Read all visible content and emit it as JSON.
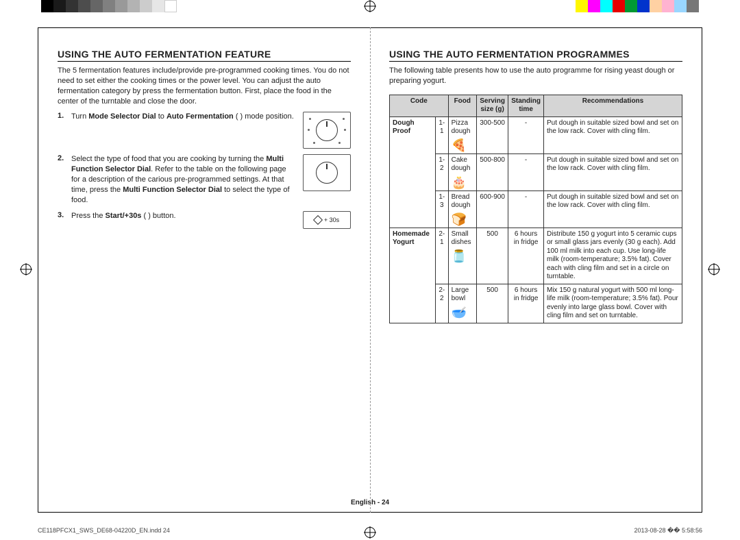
{
  "left": {
    "heading": "USING THE AUTO FERMENTATION FEATURE",
    "intro": "The 5 fermentation features include/provide pre-programmed cooking times. You do not need to set either the cooking times or the power level. You can adjust the auto fermentation category by press the fermentation button. First, place the food in the center of the turntable and close the door.",
    "step1_num": "1.",
    "step1_a": "Turn ",
    "step1_b": "Mode Selector Dial",
    "step1_c": " to ",
    "step1_d": "Auto Fermentation",
    "step1_e": " (      ) mode position.",
    "step2_num": "2.",
    "step2_a": "Select the type of food that you are cooking by turning the ",
    "step2_b": "Multi Function Selector Dial",
    "step2_c": ". Refer to the table on the following page for a description of the carious pre-programmed settings. At that time, press the ",
    "step2_d": "Multi Function Selector Dial",
    "step2_e": " to select the type of food.",
    "step3_num": "3.",
    "step3_a": "Press the ",
    "step3_b": "Start/+30s",
    "step3_c": " (    ) button.",
    "btn_label": "+ 30s"
  },
  "right": {
    "heading": "USING THE AUTO FERMENTATION PROGRAMMES",
    "intro": "The following table presents how to use the auto programme for rising yeast dough or preparing yogurt.",
    "th_code": "Code",
    "th_food": "Food",
    "th_size": "Serving size (g)",
    "th_stand": "Standing time",
    "th_rec": "Recommendations",
    "cat1": "Dough Proof",
    "cat2": "Homemade Yogurt",
    "rows": [
      {
        "code": "1-1",
        "food": "Pizza dough",
        "size": "300-500",
        "stand": "-",
        "rec": "Put dough in suitable sized bowl and set on the low rack. Cover with cling film."
      },
      {
        "code": "1-2",
        "food": "Cake dough",
        "size": "500-800",
        "stand": "-",
        "rec": "Put dough in suitable sized bowl and set on the low rack. Cover with cling film."
      },
      {
        "code": "1-3",
        "food": "Bread dough",
        "size": "600-900",
        "stand": "-",
        "rec": "Put dough in suitable sized bowl and set on the low rack. Cover with cling film."
      },
      {
        "code": "2-1",
        "food": "Small dishes",
        "size": "500",
        "stand": "6 hours in fridge",
        "rec": "Distribute 150 g yogurt into 5 ceramic cups or small glass jars evenly (30 g each). Add 100 ml milk into each cup. Use long-life milk (room-temperature; 3.5% fat). Cover each with cling film and set in a circle on turntable."
      },
      {
        "code": "2-2",
        "food": "Large bowl",
        "size": "500",
        "stand": "6 hours in fridge",
        "rec": "Mix 150 g natural yogurt with 500 ml long-life milk (room-temperature; 3.5% fat). Pour evenly into large glass bowl. Cover with cling film and set on turntable."
      }
    ]
  },
  "footer": {
    "center": "English - 24",
    "file": "CE118PFCX1_SWS_DE68-04220D_EN.indd   24",
    "date": "2013-08-28   �� 5:58:56"
  },
  "colors": {
    "left_bars": [
      "#000",
      "#1a1a1a",
      "#333",
      "#4d4d4d",
      "#666",
      "#808080",
      "#999",
      "#b3b3b3",
      "#ccc",
      "#e6e6e6",
      "#fff"
    ],
    "right_bars": [
      "#fff700",
      "#ff00ff",
      "#00ffff",
      "#e60000",
      "#009933",
      "#0033cc",
      "#ffd1a3",
      "#ffb3d1",
      "#99d6ff",
      "#777"
    ]
  }
}
